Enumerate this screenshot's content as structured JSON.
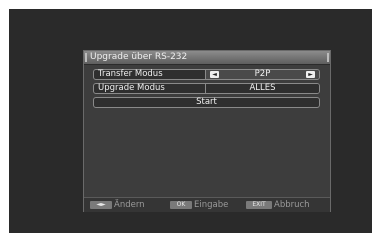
{
  "window": {
    "title": "Upgrade über RS-232"
  },
  "rows": [
    {
      "label": "Transfer Modus",
      "value": "P2P",
      "left_arrow": "◄",
      "right_arrow": "►"
    },
    {
      "label": "Upgrade Modus",
      "value": "ALLES"
    }
  ],
  "start": {
    "label": "Start"
  },
  "footer": {
    "change": {
      "key": "◄►",
      "label": "Ändern"
    },
    "ok": {
      "key": "OK",
      "label": "Eingabe"
    },
    "exit": {
      "key": "EXIT",
      "label": "Abbruch"
    }
  },
  "colors": {
    "screen": "#2a2a2a",
    "window": "#3d3d3d",
    "text": "#efefef"
  }
}
